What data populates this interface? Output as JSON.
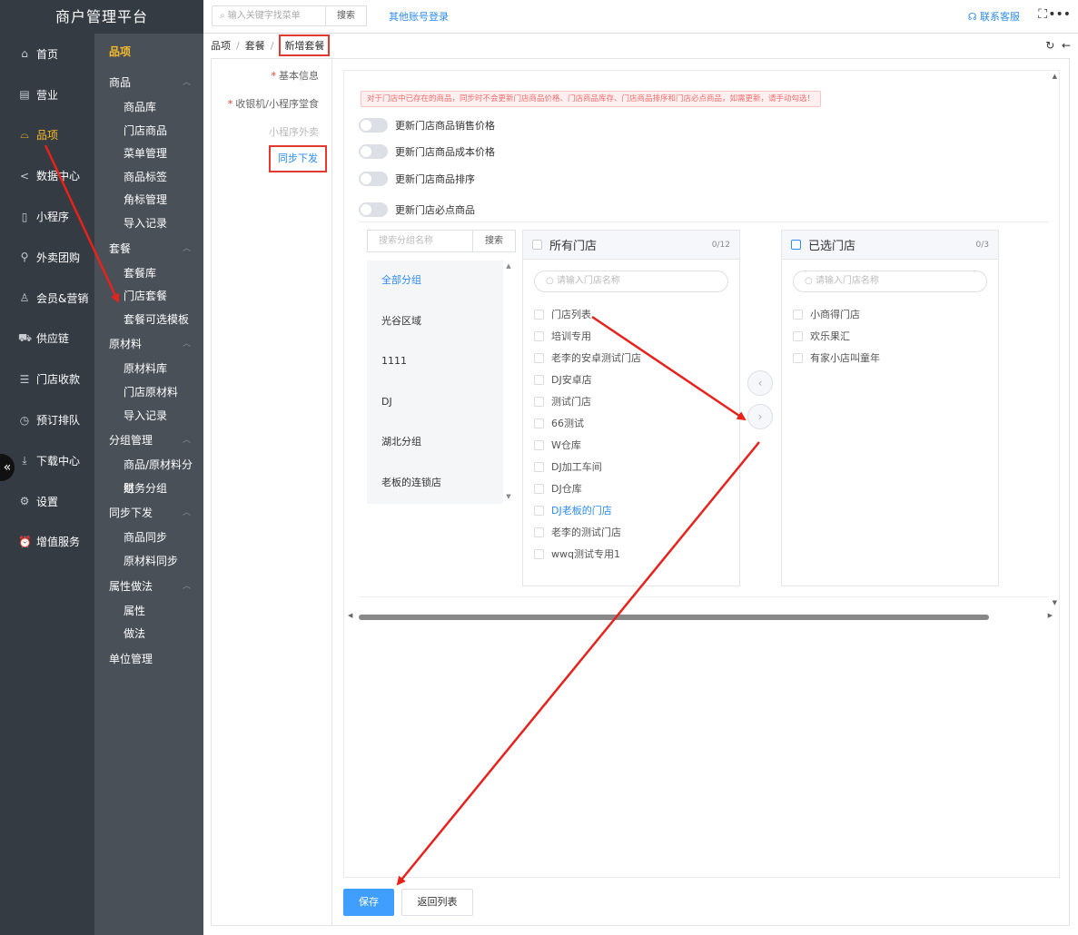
{
  "brand": "商户管理平台",
  "topbar": {
    "search_placeholder": "输入关键字找菜单",
    "search_btn": "搜索",
    "other_login": "其他账号登录",
    "contact": "联系客服"
  },
  "nav1": [
    {
      "label": "首页",
      "icon": "home-icon"
    },
    {
      "label": "营业",
      "icon": "calendar-icon"
    },
    {
      "label": "品项",
      "icon": "bag-icon",
      "active": true
    },
    {
      "label": "数据中心",
      "icon": "share-icon"
    },
    {
      "label": "小程序",
      "icon": "phone-icon"
    },
    {
      "label": "外卖团购",
      "icon": "bike-icon"
    },
    {
      "label": "会员&营销",
      "icon": "user-icon"
    },
    {
      "label": "供应链",
      "icon": "truck-icon"
    },
    {
      "label": "门店收款",
      "icon": "database-icon"
    },
    {
      "label": "预订排队",
      "icon": "clock-icon"
    },
    {
      "label": "下载中心",
      "icon": "download-icon"
    },
    {
      "label": "设置",
      "icon": "gear-icon"
    },
    {
      "label": "增值服务",
      "icon": "alarm-icon"
    }
  ],
  "nav2": {
    "head": "品项",
    "groups": [
      {
        "label": "商品",
        "items": [
          "商品库",
          "门店商品",
          "菜单管理",
          "商品标签",
          "角标管理",
          "导入记录"
        ]
      },
      {
        "label": "套餐",
        "items": [
          "套餐库",
          "门店套餐",
          "套餐可选模板"
        ]
      },
      {
        "label": "原材料",
        "items": [
          "原材料库",
          "门店原材料",
          "导入记录"
        ]
      },
      {
        "label": "分组管理",
        "items": [
          "商品/原材料分组",
          "财务分组"
        ]
      },
      {
        "label": "同步下发",
        "items": [
          "商品同步",
          "原材料同步"
        ]
      },
      {
        "label": "属性做法",
        "items": [
          "属性",
          "做法"
        ]
      }
    ],
    "last": "单位管理"
  },
  "breadcrumb": [
    "品项",
    "套餐",
    "新增套餐"
  ],
  "steps": {
    "basic": "基本信息",
    "pos": "收银机/小程序堂食",
    "takeout": "小程序外卖",
    "sync": "同步下发"
  },
  "warning": "对于门店中已存在的商品，同步时不会更新门店商品价格、门店商品库存、门店商品排序和门店必点商品，如需更新，请手动勾选！",
  "switches": [
    "更新门店商品销售价格",
    "更新门店商品成本价格",
    "更新门店商品排序",
    "更新门店必点商品"
  ],
  "groups": {
    "search_placeholder": "搜索分组名称",
    "search_btn": "搜索",
    "items": [
      "全部分组",
      "光谷区域",
      "1111",
      "DJ",
      "湖北分组",
      "老板的连锁店"
    ]
  },
  "all_stores": {
    "title": "所有门店",
    "count": "0/12",
    "search_placeholder": "请输入门店名称",
    "items": [
      "门店列表",
      "培训专用",
      "老李的安卓测试门店",
      "DJ安卓店",
      "测试门店",
      "66测试",
      "W仓库",
      "DJ加工车间",
      "DJ仓库",
      "DJ老板的门店",
      "老李的测试门店",
      "wwq测试专用1"
    ]
  },
  "selected_stores": {
    "title": "已选门店",
    "count": "0/3",
    "search_placeholder": "请输入门店名称",
    "items": [
      "小商得门店",
      "欢乐果汇",
      "有家小店叫童年"
    ]
  },
  "buttons": {
    "save": "保存",
    "back": "返回列表"
  },
  "colors": {
    "accent": "#409eff",
    "highlight": "#e23a2e",
    "active_nav": "#f7ba2a"
  }
}
